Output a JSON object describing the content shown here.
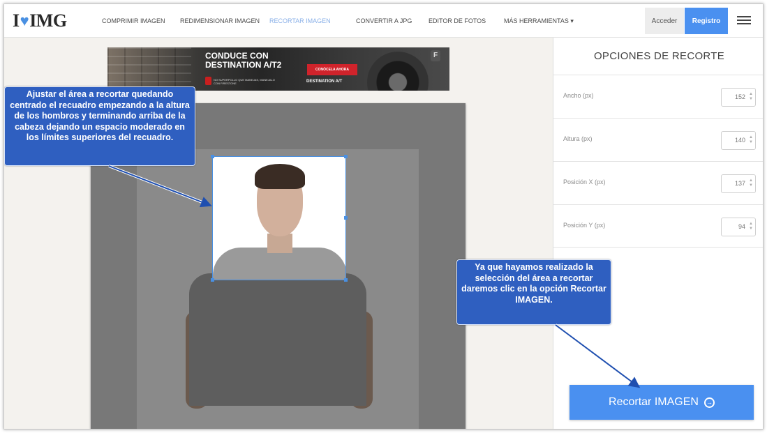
{
  "header": {
    "logo_left": "I",
    "logo_right": "IMG",
    "nav": [
      {
        "label": "COMPRIMIR IMAGEN",
        "active": false
      },
      {
        "label": "REDIMENSIONAR IMAGEN",
        "active": false
      },
      {
        "label": "RECORTAR IMAGEN",
        "active": true
      },
      {
        "label": "CONVERTIR A JPG",
        "active": false
      },
      {
        "label": "EDITOR DE FOTOS",
        "active": false
      },
      {
        "label": "MÁS HERRAMIENTAS ▾",
        "active": false
      }
    ],
    "acceder_label": "Acceder",
    "registro_label": "Registro",
    "menu_icon": "hamburger-icon"
  },
  "ad": {
    "headline": "CONDUCE CON DESTINATION A/T2",
    "cta": "CONÓCELA AHORA",
    "brand": "DESTINATION A/T",
    "fine_print": "NO SUPERPOLLO QUE MANEJAS, MANEJALO CON FIRESTONE"
  },
  "panel": {
    "title": "OPCIONES DE RECORTE",
    "fields": [
      {
        "label": "Ancho (px)",
        "value": "152"
      },
      {
        "label": "Altura (px)",
        "value": "140"
      },
      {
        "label": "Posición X (px)",
        "value": "137"
      },
      {
        "label": "Posición Y (px)",
        "value": "94"
      }
    ],
    "button_label": "Recortar IMAGEN"
  },
  "callouts": {
    "left": "Ajustar el área a recortar quedando centrado el recuadro empezando a la altura de los hombros y terminando arriba de la cabeza dejando un espacio moderado en los límites superiores del recuadro.",
    "right": "Ya que hayamos realizado la selección del área a recortar daremos clic en la opción Recortar IMAGEN."
  },
  "colors": {
    "accent": "#4a90f0",
    "callout_bg": "#2f5fc0",
    "canvas": "#787878"
  }
}
